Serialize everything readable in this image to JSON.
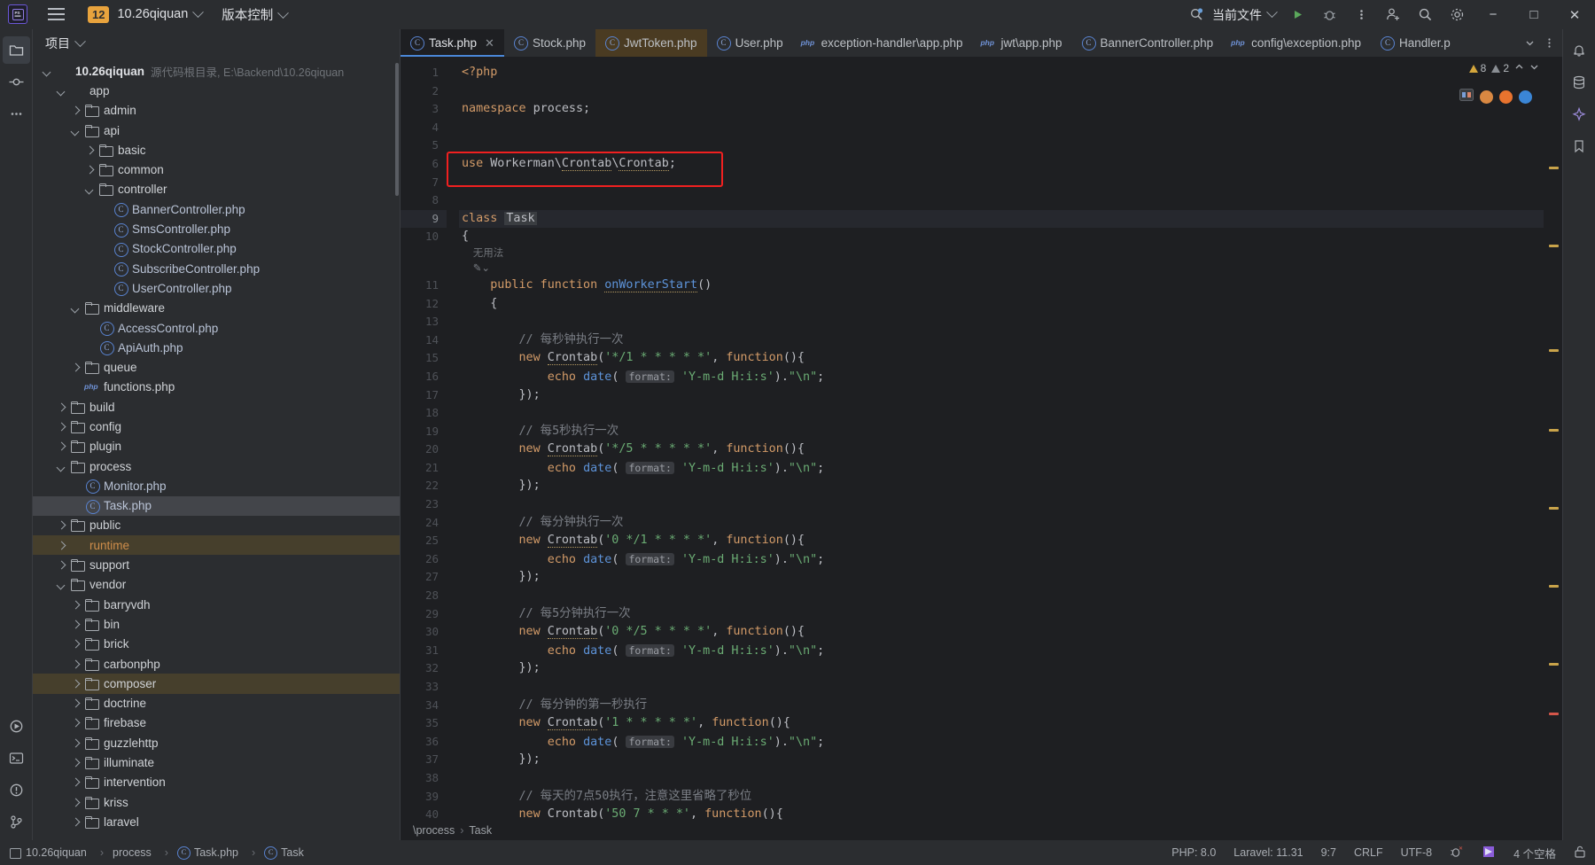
{
  "titlebar": {
    "logo": "ps-logo",
    "project_badge": "12",
    "project_name": "10.26qiquan",
    "vcs_label": "版本控制",
    "current_file_label": "当前文件",
    "icons": [
      "bug-search-icon",
      "run-icon",
      "debug-icon",
      "more-actions-icon",
      "add-user-icon",
      "search-icon",
      "settings-gear-icon"
    ],
    "window": {
      "minimize": "−",
      "maximize": "□",
      "close": "✕"
    }
  },
  "left_toolstrip": {
    "icons": [
      "project-folder-icon",
      "commit-icon",
      "more-tool-windows-icon",
      "services-icon",
      "terminal-icon",
      "problems-icon",
      "version-control-icon"
    ]
  },
  "right_toolstrip": {
    "icons": [
      "notifications-bell-icon",
      "database-icon",
      "ai-assistant-icon",
      "bookmark-icon"
    ]
  },
  "project_panel": {
    "title": "项目",
    "tree": [
      {
        "depth": 0,
        "arrow": "open",
        "icon": "folder-blue",
        "label": "10.26qiquan",
        "bold": true,
        "sub": "源代码根目录, E:\\Backend\\10.26qiquan"
      },
      {
        "depth": 1,
        "arrow": "open",
        "icon": "folder-blue",
        "label": "app"
      },
      {
        "depth": 2,
        "arrow": "closed",
        "icon": "folder",
        "label": "admin"
      },
      {
        "depth": 2,
        "arrow": "open",
        "icon": "folder",
        "label": "api"
      },
      {
        "depth": 3,
        "arrow": "closed",
        "icon": "folder",
        "label": "basic"
      },
      {
        "depth": 3,
        "arrow": "closed",
        "icon": "folder",
        "label": "common"
      },
      {
        "depth": 3,
        "arrow": "open",
        "icon": "folder",
        "label": "controller"
      },
      {
        "depth": 4,
        "arrow": "none",
        "icon": "php-class",
        "label": "BannerController.php"
      },
      {
        "depth": 4,
        "arrow": "none",
        "icon": "php-class",
        "label": "SmsController.php"
      },
      {
        "depth": 4,
        "arrow": "none",
        "icon": "php-class",
        "label": "StockController.php"
      },
      {
        "depth": 4,
        "arrow": "none",
        "icon": "php-class",
        "label": "SubscribeController.php"
      },
      {
        "depth": 4,
        "arrow": "none",
        "icon": "php-class",
        "label": "UserController.php"
      },
      {
        "depth": 2,
        "arrow": "open",
        "icon": "folder",
        "label": "middleware"
      },
      {
        "depth": 3,
        "arrow": "none",
        "icon": "php-class",
        "label": "AccessControl.php"
      },
      {
        "depth": 3,
        "arrow": "none",
        "icon": "php-class",
        "label": "ApiAuth.php"
      },
      {
        "depth": 2,
        "arrow": "closed",
        "icon": "folder",
        "label": "queue"
      },
      {
        "depth": 2,
        "arrow": "none",
        "icon": "php-file",
        "label": "functions.php"
      },
      {
        "depth": 1,
        "arrow": "closed",
        "icon": "folder",
        "label": "build"
      },
      {
        "depth": 1,
        "arrow": "closed",
        "icon": "folder",
        "label": "config"
      },
      {
        "depth": 1,
        "arrow": "closed",
        "icon": "folder",
        "label": "plugin"
      },
      {
        "depth": 1,
        "arrow": "open",
        "icon": "folder",
        "label": "process"
      },
      {
        "depth": 2,
        "arrow": "none",
        "icon": "php-class",
        "label": "Monitor.php"
      },
      {
        "depth": 2,
        "arrow": "none",
        "icon": "php-class",
        "label": "Task.php",
        "state": "selected"
      },
      {
        "depth": 1,
        "arrow": "closed",
        "icon": "folder",
        "label": "public"
      },
      {
        "depth": 1,
        "arrow": "closed",
        "icon": "folder-orange",
        "label": "runtime",
        "state": "modified"
      },
      {
        "depth": 1,
        "arrow": "closed",
        "icon": "folder",
        "label": "support"
      },
      {
        "depth": 1,
        "arrow": "open",
        "icon": "folder",
        "label": "vendor"
      },
      {
        "depth": 2,
        "arrow": "closed",
        "icon": "folder",
        "label": "barryvdh"
      },
      {
        "depth": 2,
        "arrow": "closed",
        "icon": "folder",
        "label": "bin"
      },
      {
        "depth": 2,
        "arrow": "closed",
        "icon": "folder",
        "label": "brick"
      },
      {
        "depth": 2,
        "arrow": "closed",
        "icon": "folder",
        "label": "carbonphp"
      },
      {
        "depth": 2,
        "arrow": "closed",
        "icon": "folder",
        "label": "composer",
        "state": "modified"
      },
      {
        "depth": 2,
        "arrow": "closed",
        "icon": "folder",
        "label": "doctrine"
      },
      {
        "depth": 2,
        "arrow": "closed",
        "icon": "folder",
        "label": "firebase"
      },
      {
        "depth": 2,
        "arrow": "closed",
        "icon": "folder",
        "label": "guzzlehttp"
      },
      {
        "depth": 2,
        "arrow": "closed",
        "icon": "folder",
        "label": "illuminate"
      },
      {
        "depth": 2,
        "arrow": "closed",
        "icon": "folder",
        "label": "intervention"
      },
      {
        "depth": 2,
        "arrow": "closed",
        "icon": "folder",
        "label": "kriss"
      },
      {
        "depth": 2,
        "arrow": "closed",
        "icon": "folder",
        "label": "laravel"
      }
    ]
  },
  "editor": {
    "tabs": [
      {
        "label": "Task.php",
        "icon": "php-class-icon",
        "state": "active",
        "closable": true
      },
      {
        "label": "Stock.php",
        "icon": "php-class-icon",
        "state": "normal"
      },
      {
        "label": "JwtToken.php",
        "icon": "php-class-icon",
        "state": "modified"
      },
      {
        "label": "User.php",
        "icon": "php-class-icon",
        "state": "normal"
      },
      {
        "label": "exception-handler\\app.php",
        "icon": "php-file-icon",
        "state": "normal"
      },
      {
        "label": "jwt\\app.php",
        "icon": "php-file-icon",
        "state": "normal"
      },
      {
        "label": "BannerController.php",
        "icon": "php-class-icon",
        "state": "normal"
      },
      {
        "label": "config\\exception.php",
        "icon": "php-file-icon",
        "state": "normal"
      },
      {
        "label": "Handler.p",
        "icon": "php-class-icon",
        "state": "normal"
      }
    ],
    "tab_overflow_icon": "chevron-down-icon",
    "tab_options_icon": "more-options-icon",
    "inspection": {
      "warnings": "8",
      "weak_warnings": "2",
      "warn_icon": "warning-triangle-icon"
    },
    "annotation_box": {
      "label": "red-highlight-box",
      "color": "#f02020",
      "target_line": 6
    },
    "inlay_hint": "无用法",
    "lines": [
      {
        "n": 1,
        "html": "<span class=\"kw\">&lt;?php</span>"
      },
      {
        "n": 2,
        "html": ""
      },
      {
        "n": 3,
        "html": "<span class=\"kw\">namespace</span> process;"
      },
      {
        "n": 4,
        "html": ""
      },
      {
        "n": 5,
        "html": ""
      },
      {
        "n": 6,
        "html": "<span class=\"kw\">use</span> Workerman\\<span class=\"wavy\">Crontab</span>\\<span class=\"wavy\">Crontab</span>;"
      },
      {
        "n": 7,
        "html": ""
      },
      {
        "n": 8,
        "html": ""
      },
      {
        "n": 9,
        "html": "<span class=\"kw\">class</span> <span class=\"cls-hl\">Task</span>",
        "highlight": true
      },
      {
        "n": 10,
        "html": "{"
      },
      {
        "n": 11,
        "html": "    <span class=\"kw\">public function</span> <span class=\"fn\"><span class=\"wavy\">onWorkerStart</span></span>()"
      },
      {
        "n": 12,
        "html": "    {"
      },
      {
        "n": 13,
        "html": ""
      },
      {
        "n": 14,
        "html": "        <span class=\"cmt\">// 每秒钟执行一次</span>"
      },
      {
        "n": 15,
        "html": "        <span class=\"kw\">new</span> <span class=\"wavy\">Crontab</span>(<span class=\"str\">'*/1 * * * * *'</span>, <span class=\"kw\">function</span>(){"
      },
      {
        "n": 16,
        "html": "            <span class=\"kw\">echo</span> <span class=\"fn\">date</span>( <span class=\"param\">format:</span> <span class=\"str\">'Y-m-d H:i:s'</span>).<span class=\"str\">\"\\n\"</span>;"
      },
      {
        "n": 17,
        "html": "        });"
      },
      {
        "n": 18,
        "html": ""
      },
      {
        "n": 19,
        "html": "        <span class=\"cmt\">// 每5秒执行一次</span>"
      },
      {
        "n": 20,
        "html": "        <span class=\"kw\">new</span> <span class=\"wavy\">Crontab</span>(<span class=\"str\">'*/5 * * * * *'</span>, <span class=\"kw\">function</span>(){"
      },
      {
        "n": 21,
        "html": "            <span class=\"kw\">echo</span> <span class=\"fn\">date</span>( <span class=\"param\">format:</span> <span class=\"str\">'Y-m-d H:i:s'</span>).<span class=\"str\">\"\\n\"</span>;"
      },
      {
        "n": 22,
        "html": "        });"
      },
      {
        "n": 23,
        "html": ""
      },
      {
        "n": 24,
        "html": "        <span class=\"cmt\">// 每分钟执行一次</span>"
      },
      {
        "n": 25,
        "html": "        <span class=\"kw\">new</span> <span class=\"wavy\">Crontab</span>(<span class=\"str\">'0 */1 * * * *'</span>, <span class=\"kw\">function</span>(){"
      },
      {
        "n": 26,
        "html": "            <span class=\"kw\">echo</span> <span class=\"fn\">date</span>( <span class=\"param\">format:</span> <span class=\"str\">'Y-m-d H:i:s'</span>).<span class=\"str\">\"\\n\"</span>;"
      },
      {
        "n": 27,
        "html": "        });"
      },
      {
        "n": 28,
        "html": ""
      },
      {
        "n": 29,
        "html": "        <span class=\"cmt\">// 每5分钟执行一次</span>"
      },
      {
        "n": 30,
        "html": "        <span class=\"kw\">new</span> <span class=\"wavy\">Crontab</span>(<span class=\"str\">'0 */5 * * * *'</span>, <span class=\"kw\">function</span>(){"
      },
      {
        "n": 31,
        "html": "            <span class=\"kw\">echo</span> <span class=\"fn\">date</span>( <span class=\"param\">format:</span> <span class=\"str\">'Y-m-d H:i:s'</span>).<span class=\"str\">\"\\n\"</span>;"
      },
      {
        "n": 32,
        "html": "        });"
      },
      {
        "n": 33,
        "html": ""
      },
      {
        "n": 34,
        "html": "        <span class=\"cmt\">// 每分钟的第一秒执行</span>"
      },
      {
        "n": 35,
        "html": "        <span class=\"kw\">new</span> <span class=\"wavy\">Crontab</span>(<span class=\"str\">'1 * * * * *'</span>, <span class=\"kw\">function</span>(){"
      },
      {
        "n": 36,
        "html": "            <span class=\"kw\">echo</span> <span class=\"fn\">date</span>( <span class=\"param\">format:</span> <span class=\"str\">'Y-m-d H:i:s'</span>).<span class=\"str\">\"\\n\"</span>;"
      },
      {
        "n": 37,
        "html": "        });"
      },
      {
        "n": 38,
        "html": ""
      },
      {
        "n": 39,
        "html": "        <span class=\"cmt\">// 每天的7点50执行，注意这里省略了秒位</span>"
      },
      {
        "n": 40,
        "html": "        <span class=\"kw\">new</span> <span class=\"wavy\">Crontab</span>(<span class=\"str\">'50 7 * * *'</span>, <span class=\"kw\">function</span>(){"
      }
    ]
  },
  "breadcrumb": {
    "items": [
      "\\process",
      "Task"
    ]
  },
  "statusbar": {
    "left": [
      {
        "icon": "project-icon",
        "label": "10.26qiquan"
      },
      {
        "icon": "folder-icon",
        "label": "process"
      },
      {
        "icon": "php-class-icon",
        "label": "Task.php"
      },
      {
        "icon": "php-class-icon",
        "label": "Task"
      }
    ],
    "right": [
      "PHP: 8.0",
      "Laravel: 11.31",
      "9:7",
      "CRLF",
      "UTF-8",
      "4 个空格"
    ],
    "right_icons": [
      "inspection-bug-icon",
      "ide-logo-icon",
      "lock-icon"
    ]
  },
  "colors": {
    "accent_blue": "#4a88d8",
    "modified_tab": "#4a3b22",
    "highlight_red": "#f02020",
    "badge_orange": "#e8a33d",
    "string_green": "#6aab73",
    "keyword_orange": "#d39b68"
  }
}
